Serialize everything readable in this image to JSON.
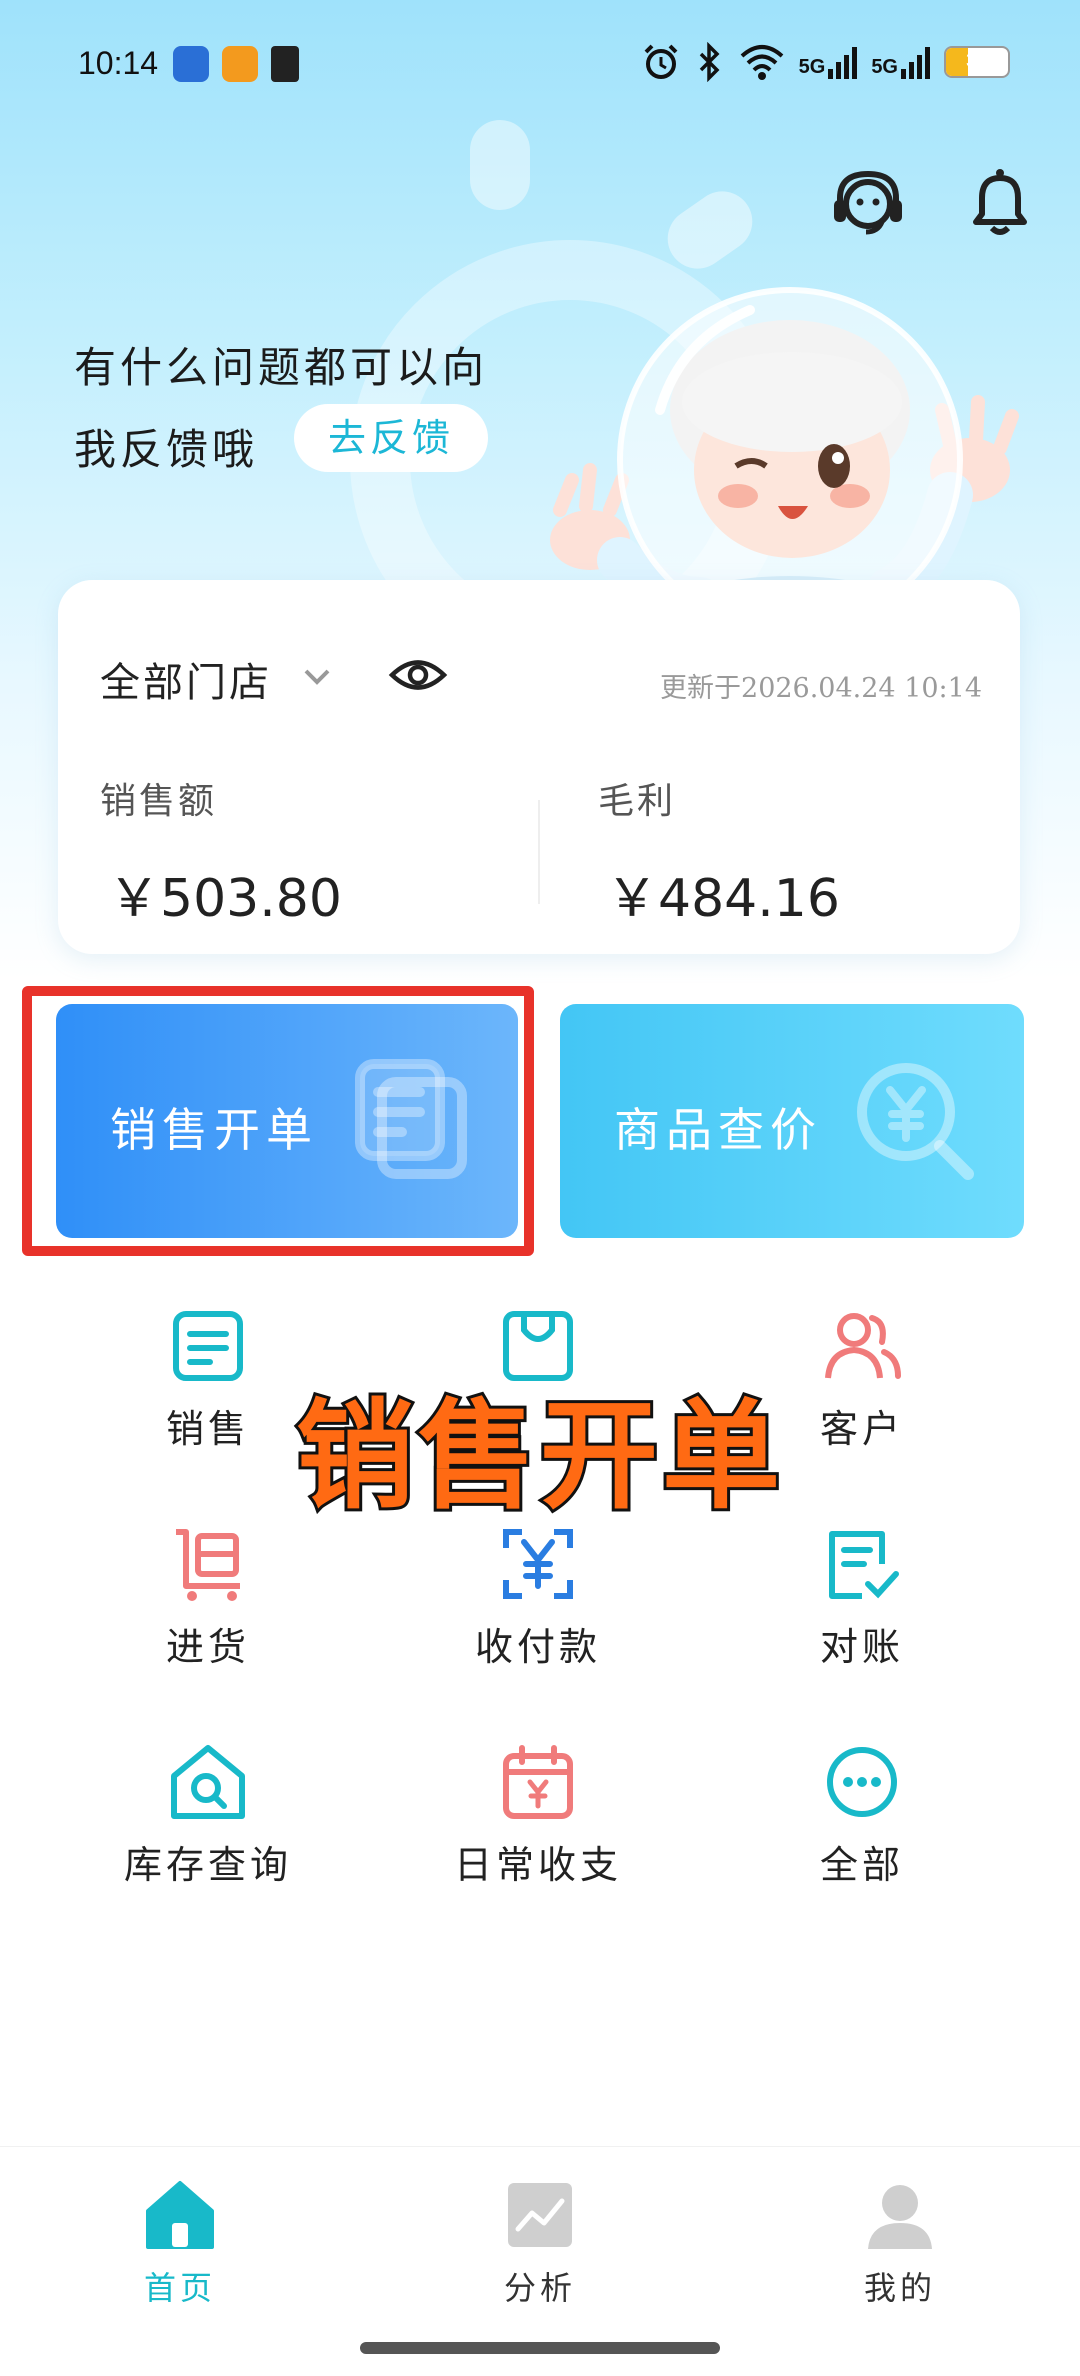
{
  "status_bar": {
    "time": "10:14",
    "battery_percent": "35",
    "battery_level": 0.35,
    "signal_1": "5G",
    "signal_2": "5G",
    "icons": [
      "app-icon-1",
      "app-icon-2",
      "app-icon-3",
      "alarm-icon",
      "bluetooth-icon",
      "wifi-icon",
      "signal-icon",
      "signal-icon",
      "battery-icon"
    ]
  },
  "header": {
    "icons": [
      "customer-service-icon",
      "bell-icon"
    ]
  },
  "feedback": {
    "line1": "有什么问题都可以向",
    "line2": "我反馈哦",
    "button": "去反馈"
  },
  "stats": {
    "store": "全部门店",
    "updated": "更新于2026.04.24  10:14",
    "sales_label": "销售额",
    "sales_value": "￥503.80",
    "profit_label": "毛利",
    "profit_value": "￥484.16"
  },
  "actions": {
    "sales_order": "销售开单",
    "price_check": "商品查价"
  },
  "grid": {
    "row1": [
      "销售",
      "",
      "客户"
    ],
    "row2": [
      "进货",
      "收付款",
      "对账"
    ],
    "row3": [
      "库存查询",
      "日常收支",
      "全部"
    ]
  },
  "overlay_text": "销售开单",
  "nav": {
    "home": "首页",
    "analysis": "分析",
    "mine": "我的"
  },
  "colors": {
    "accent": "#1cb7d6",
    "highlight_red": "#e8322a",
    "overlay_orange": "#ff6a13",
    "sales_card_start": "#2f8ff8",
    "price_card_start": "#43c6f5"
  }
}
